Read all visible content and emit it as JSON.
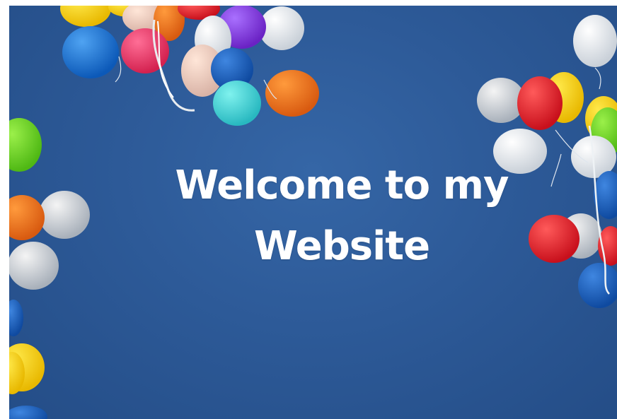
{
  "hero": {
    "title_line1": "Welcome to my",
    "title_line2": "Website"
  },
  "colors": {
    "sky": "#2d5a98",
    "title": "#ffffff"
  }
}
